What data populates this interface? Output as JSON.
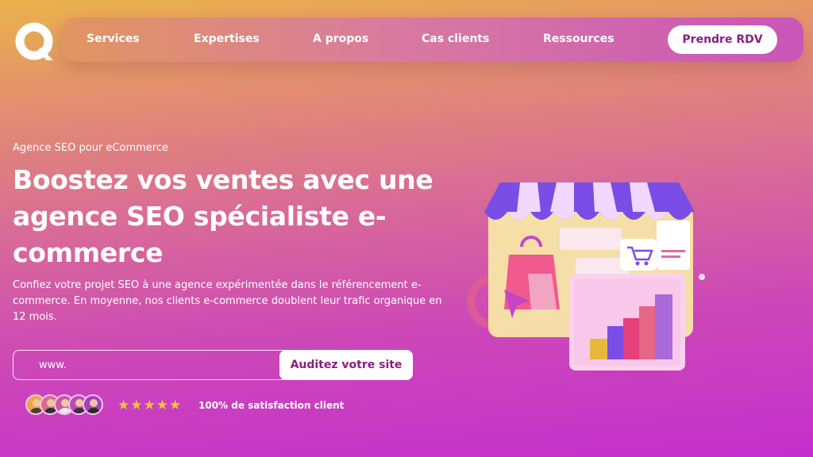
{
  "brand": {
    "logo": "q-logo-icon"
  },
  "nav": {
    "items": [
      {
        "label": "Services"
      },
      {
        "label": "Expertises"
      },
      {
        "label": "A propos"
      },
      {
        "label": "Cas clients"
      },
      {
        "label": "Ressources"
      }
    ],
    "cta_label": "Prendre RDV"
  },
  "hero": {
    "eyebrow": "Agence SEO pour eCommerce",
    "title": "Boostez vos ventes avec une agence SEO spécialiste e-commerce",
    "description": "Confiez votre projet SEO à une agence expérimentée dans le référencement e-commerce. En moyenne, nos clients e-commerce doublent leur trafic organique en 12 mois."
  },
  "audit_form": {
    "input_placeholder": "www.",
    "input_value": "",
    "submit_label": "Auditez votre site"
  },
  "social_proof": {
    "avatars": [
      "avatar-1",
      "avatar-2",
      "avatar-3",
      "avatar-4",
      "avatar-5"
    ],
    "stars": "★★★★★",
    "rating_value": 5,
    "rating_text": "100% de satisfaction client"
  },
  "illustration": {
    "icons": [
      "shop-awning-icon",
      "shopping-bag-icon",
      "cart-icon",
      "cursor-icon",
      "bar-chart-icon"
    ]
  },
  "colors": {
    "gradient_top": "#e9b24a",
    "gradient_bottom": "#c42fcc",
    "accent_text": "#8a1f7f",
    "star": "#f3c43f",
    "awning_purple": "#7a4de6"
  }
}
